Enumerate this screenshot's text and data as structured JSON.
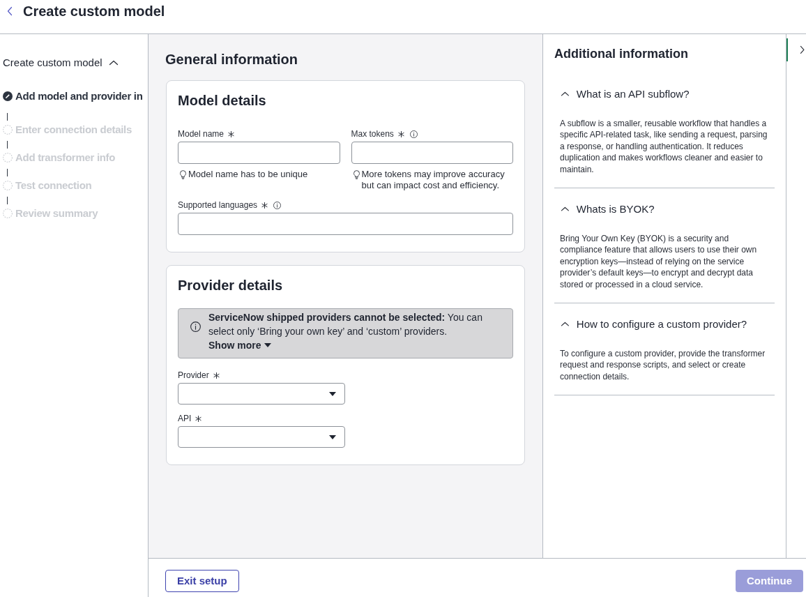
{
  "header": {
    "title": "Create custom model"
  },
  "stepper": {
    "title": "Create custom model",
    "expanded": true,
    "steps": [
      {
        "label": "Add model and provider in",
        "selected": true
      },
      {
        "label": "Enter connection details",
        "selected": false
      },
      {
        "label": "Add transformer info",
        "selected": false
      },
      {
        "label": "Test connection",
        "selected": false
      },
      {
        "label": "Review summary",
        "selected": false
      }
    ]
  },
  "form": {
    "title": "General information",
    "sections": [
      {
        "title": "Model details",
        "rows": [
          [
            {
              "kind": "text",
              "label": "Model name",
              "required": true,
              "info": false,
              "hint": "Model name has to be unique"
            },
            {
              "kind": "text",
              "label": "Max tokens",
              "required": true,
              "info": true,
              "hint": "More tokens may improve accuracy but can impact cost and efficiency."
            }
          ],
          [
            {
              "kind": "text",
              "label": "Supported languages",
              "required": true,
              "info": true
            }
          ]
        ]
      },
      {
        "title": "Provider details",
        "notice": {
          "text": "**ServiceNow shipped providers cannot be selected:** You can select only ‘Bring your own key’ and ‘custom’ providers.",
          "toggle": "Show more",
          "expanded": false
        },
        "rows": [
          [
            {
              "kind": "select",
              "label": "Provider",
              "required": true,
              "info": false
            }
          ],
          [
            {
              "kind": "select",
              "label": "API",
              "required": true,
              "info": false
            }
          ]
        ]
      }
    ]
  },
  "help_panel": {
    "title": "Additional information",
    "items": [
      {
        "title": "What is an API subflow?",
        "expanded": true,
        "body": "A subflow is a smaller, reusable workflow that handles a specific API-related task, like sending a request, parsing a response, or handling authentication. It reduces duplication and makes workflows cleaner and easier to maintain."
      },
      {
        "title": "Whats is BYOK?",
        "expanded": true,
        "body": "Bring Your Own Key (BYOK) is a security and compliance feature that allows users to use their own encryption keys—instead of relying on the service provider’s default keys—to encrypt and decrypt data stored or processed in a cloud service."
      },
      {
        "title": "How to configure a custom provider?",
        "expanded": true,
        "body": "To configure a custom provider, provide the transformer request and response scripts, and select or create connection details."
      }
    ]
  },
  "panel_toggle": {
    "selected": true
  },
  "footer": {
    "buttons": [
      {
        "label": "Exit setup",
        "kind": "secondary",
        "disabled": false
      },
      {
        "label": "Continue",
        "kind": "primary",
        "disabled": true
      }
    ]
  }
}
